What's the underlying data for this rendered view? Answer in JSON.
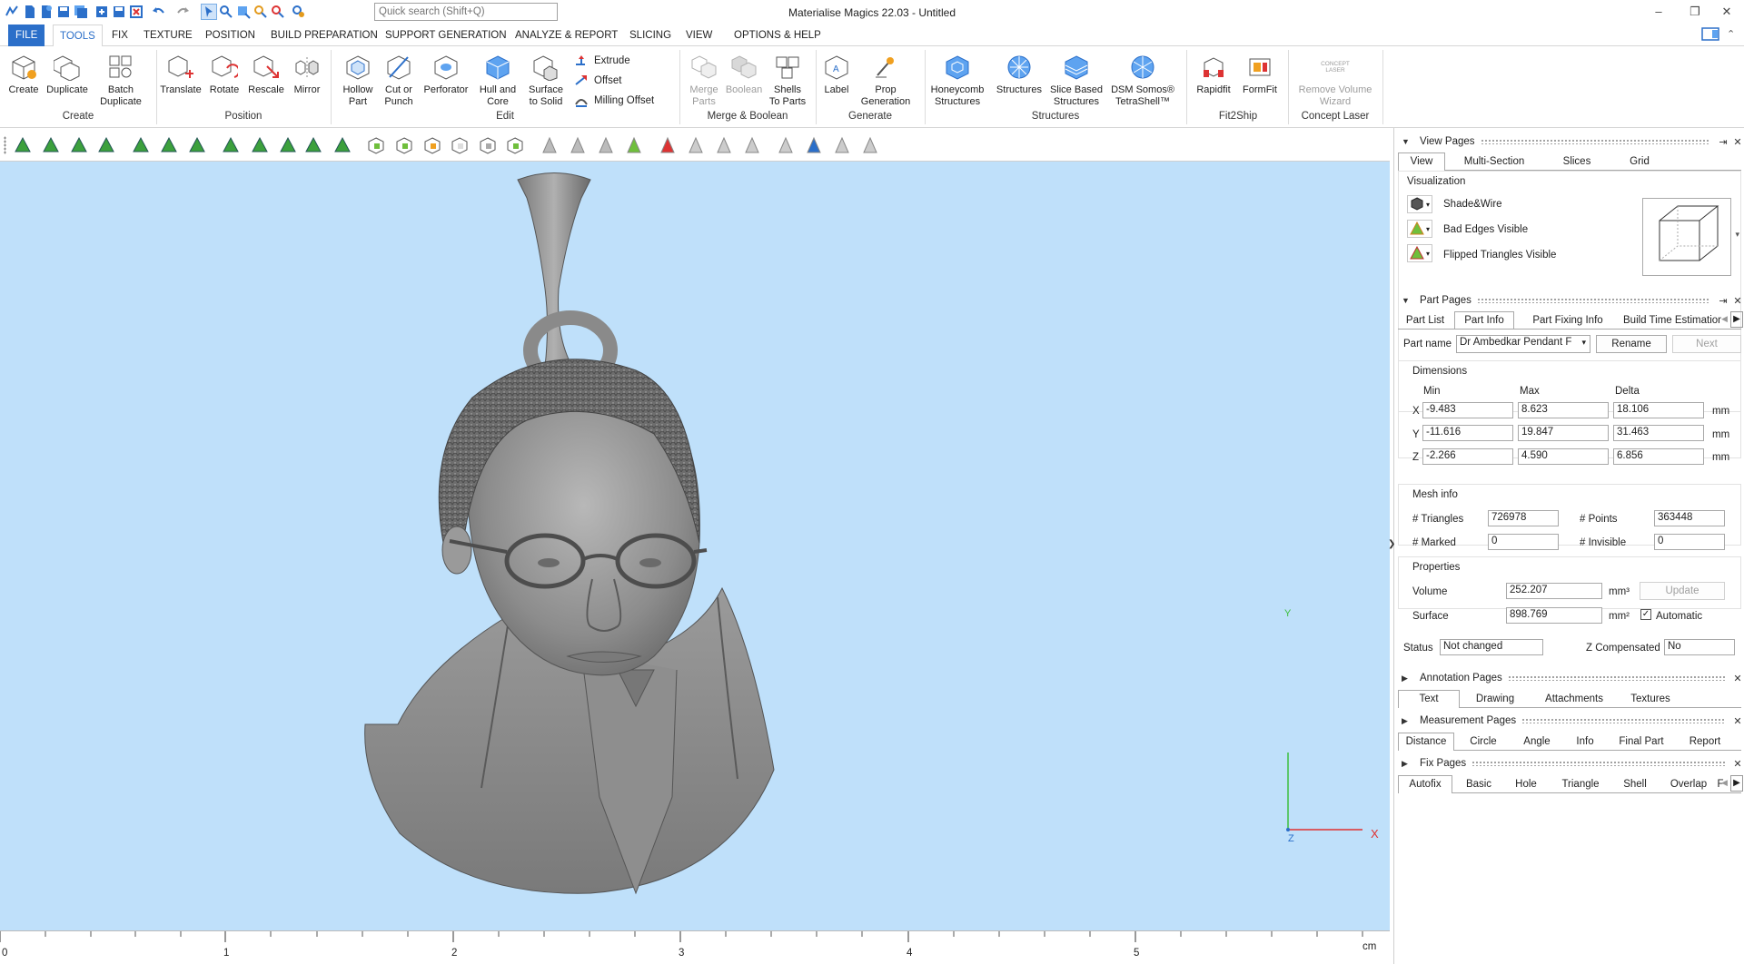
{
  "window": {
    "title": "Materialise Magics 22.03 - Untitled",
    "search_placeholder": "Quick search (Shift+Q)",
    "controls": [
      "–",
      "❐",
      "✕"
    ]
  },
  "menu": {
    "file": "FILE",
    "items": [
      "TOOLS",
      "FIX",
      "TEXTURE",
      "POSITION",
      "BUILD PREPARATION",
      "SUPPORT GENERATION",
      "ANALYZE & REPORT",
      "SLICING",
      "VIEW",
      "OPTIONS & HELP"
    ],
    "active": "TOOLS"
  },
  "ribbon": {
    "buttons": {
      "create": "Create",
      "duplicate": "Duplicate",
      "batch_duplicate": "Batch\nDuplicate",
      "translate": "Translate",
      "rotate": "Rotate",
      "rescale": "Rescale",
      "mirror": "Mirror",
      "hollow_part": "Hollow\nPart",
      "cut_or_punch": "Cut or\nPunch",
      "perforator": "Perforator",
      "hull_and_core": "Hull and\nCore",
      "surface_to_solid": "Surface\nto Solid",
      "extrude": "Extrude",
      "offset": "Offset",
      "milling_offset": "Milling Offset",
      "merge_parts": "Merge\nParts",
      "boolean": "Boolean",
      "shells_to_parts": "Shells\nTo Parts",
      "label": "Label",
      "prop_generation": "Prop\nGeneration",
      "honeycomb_structures": "Honeycomb\nStructures",
      "structures": "Structures",
      "slice_based_structures": "Slice Based\nStructures",
      "dsm_somos": "DSM Somos®\nTetraShell™",
      "rapidfit": "Rapidfit",
      "formfit": "FormFit",
      "remove_volume_wizard": "Remove Volume\nWizard",
      "concept_laser_icon_text": "CONCEPT\nLASER"
    },
    "groups": {
      "create": "Create",
      "position": "Position",
      "edit": "Edit",
      "merge_boolean": "Merge & Boolean",
      "generate": "Generate",
      "structures": "Structures",
      "fit2ship": "Fit2Ship",
      "concept_laser": "Concept Laser"
    }
  },
  "viewport": {
    "axis_y": "Y",
    "axis_z": "Z",
    "axis_x": "X",
    "ruler": {
      "ticks": [
        "0",
        "1",
        "2",
        "3",
        "4",
        "5"
      ],
      "unit": "cm"
    }
  },
  "panel": {
    "view_pages": {
      "title": "View Pages",
      "tabs": [
        "View",
        "Multi-Section",
        "Slices",
        "Grid"
      ],
      "visualization_label": "Visualization",
      "options": [
        "Shade&Wire",
        "Bad Edges Visible",
        "Flipped Triangles Visible"
      ]
    },
    "part_pages": {
      "title": "Part Pages",
      "tabs": [
        "Part List",
        "Part Info",
        "Part Fixing Info",
        "Build Time Estimation"
      ],
      "part_name_label": "Part name",
      "part_name": "Dr Ambedkar Pendant F",
      "rename": "Rename",
      "next": "Next",
      "dimensions_label": "Dimensions",
      "col_min": "Min",
      "col_max": "Max",
      "col_delta": "Delta",
      "unit": "mm",
      "rows": [
        {
          "axis": "X",
          "min": "-9.483",
          "max": "8.623",
          "delta": "18.106"
        },
        {
          "axis": "Y",
          "min": "-11.616",
          "max": "19.847",
          "delta": "31.463"
        },
        {
          "axis": "Z",
          "min": "-2.266",
          "max": "4.590",
          "delta": "6.856"
        }
      ],
      "mesh_info_label": "Mesh info",
      "triangles_label": "# Triangles",
      "triangles": "726978",
      "points_label": "# Points",
      "points": "363448",
      "marked_label": "# Marked",
      "marked": "0",
      "invisible_label": "# Invisible",
      "invisible": "0",
      "properties_label": "Properties",
      "volume_label": "Volume",
      "volume": "252.207",
      "volume_unit": "mm³",
      "update": "Update",
      "surface_label": "Surface",
      "surface": "898.769",
      "surface_unit": "mm²",
      "automatic": "Automatic",
      "status_label": "Status",
      "status": "Not changed",
      "zcomp_label": "Z Compensated",
      "zcomp": "No"
    },
    "annotation_pages": {
      "title": "Annotation Pages",
      "tabs": [
        "Text",
        "Drawing",
        "Attachments",
        "Textures"
      ]
    },
    "measurement_pages": {
      "title": "Measurement Pages",
      "tabs": [
        "Distance",
        "Circle",
        "Angle",
        "Info",
        "Final Part",
        "Report"
      ]
    },
    "fix_pages": {
      "title": "Fix Pages",
      "tabs": [
        "Autofix",
        "Basic",
        "Hole",
        "Triangle",
        "Shell",
        "Overlap",
        "F"
      ]
    }
  },
  "colors": {
    "accent": "#2b6fc9",
    "viewport_bg": "#bfe0fa",
    "model": "#8a8a8a",
    "axis_y": "#3cbf3c",
    "axis_x": "#e03030"
  }
}
